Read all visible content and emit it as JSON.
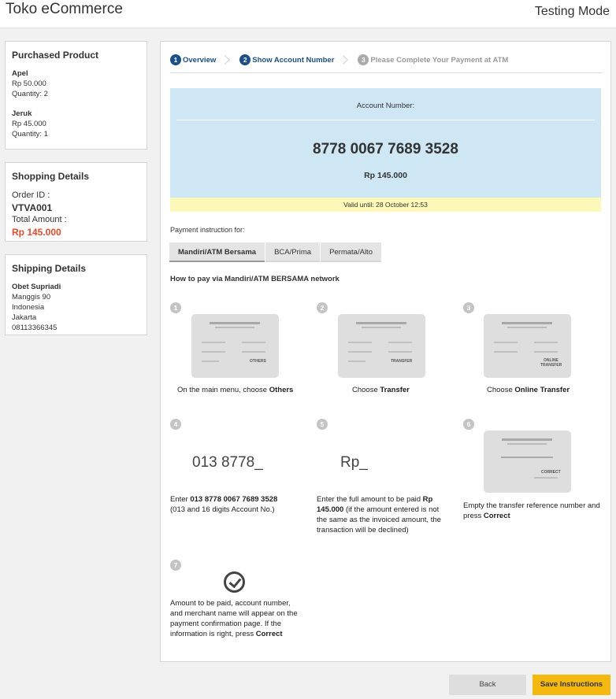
{
  "header": {
    "title": "Toko eCommerce",
    "mode": "Testing Mode"
  },
  "purchased": {
    "title": "Purchased Product",
    "items": [
      {
        "name": "Apel",
        "price": "Rp 50.000",
        "qty": "Quantity: 2"
      },
      {
        "name": "Jeruk",
        "price": "Rp 45.000",
        "qty": "Quantity: 1"
      }
    ]
  },
  "shopping": {
    "title": "Shopping Details",
    "order_label": "Order ID :",
    "order_id": "VTVA001",
    "total_label": "Total Amount :",
    "total": "Rp 145.000"
  },
  "shipping": {
    "title": "Shipping Details",
    "name": "Obet Supriadi",
    "street": "Manggis 90",
    "country": "Indonesia",
    "city": "Jakarta",
    "phone": "08113366345"
  },
  "steps": [
    {
      "num": "1",
      "label": "Overview"
    },
    {
      "num": "2",
      "label": "Show Account Number"
    },
    {
      "num": "3",
      "label": "Please Complete Your Payment at ATM"
    }
  ],
  "account": {
    "label": "Account Number:",
    "number": "8778 0067 7689 3528",
    "amount": "Rp 145.000",
    "valid": "Valid until: 28 October 12:53"
  },
  "instructions": {
    "label": "Payment instruction for:",
    "tabs": [
      "Mandiri/ATM Bersama",
      "BCA/Prima",
      "Permata/Alto"
    ],
    "howto": "How to pay via Mandiri/ATM BERSAMA network",
    "steps": [
      {
        "num": "1",
        "screen_label": "OTHERS",
        "caption_pre": "On the main menu, choose ",
        "caption_bold": "Others",
        "caption_post": ""
      },
      {
        "num": "2",
        "screen_label": "TRANSFER",
        "caption_pre": "Choose ",
        "caption_bold": "Transfer",
        "caption_post": ""
      },
      {
        "num": "3",
        "screen_label_1": "ONLINE",
        "screen_label_2": "TRANSFER",
        "caption_pre": "Choose ",
        "caption_bold": "Online Transfer",
        "caption_post": ""
      },
      {
        "num": "4",
        "display": "013 8778_",
        "caption_pre": "Enter ",
        "caption_bold": "013 8778 0067 7689 3528",
        "caption_post": "(013 and 16 digits Account No.)"
      },
      {
        "num": "5",
        "display": "Rp_",
        "caption_pre": "Enter the full amount to be paid ",
        "caption_bold": "Rp 145.000",
        "caption_post": " (if the amount entered is not the same as the invoiced amount, the transaction will be declined)"
      },
      {
        "num": "6",
        "screen_label": "CORRECT",
        "caption_pre": "Empty the transfer reference number and press ",
        "caption_bold": "Correct",
        "caption_post": ""
      },
      {
        "num": "7",
        "icon": "check-circle",
        "caption_pre": "Amount to be paid, account number, and merchant name will appear on the payment confirmation page. If the information is right, press ",
        "caption_bold": "Correct",
        "caption_post": ""
      }
    ]
  },
  "buttons": {
    "back": "Back",
    "save": "Save Instructions"
  }
}
